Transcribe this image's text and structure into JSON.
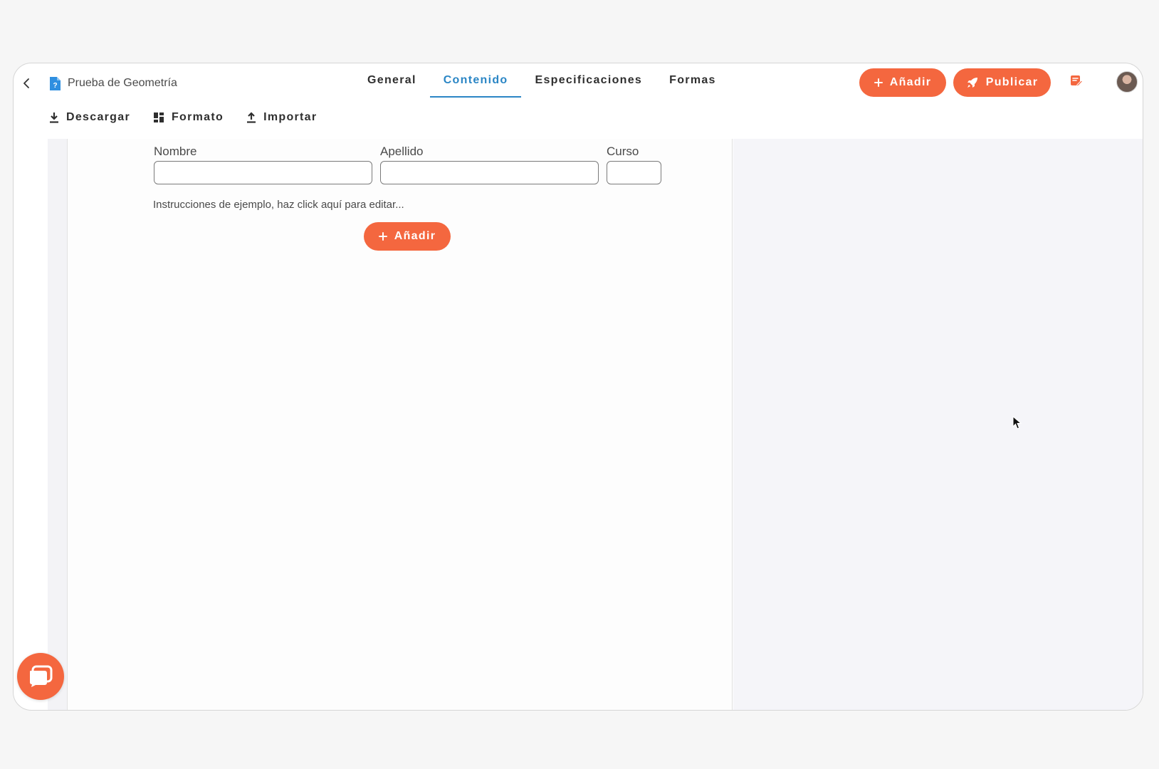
{
  "header": {
    "title": "Prueba de Geometría",
    "tabs": [
      {
        "label": "General",
        "active": false
      },
      {
        "label": "Contenido",
        "active": true
      },
      {
        "label": "Especificaciones",
        "active": false
      },
      {
        "label": "Formas",
        "active": false
      }
    ],
    "add_button": "Añadir",
    "publish_button": "Publicar"
  },
  "toolbar": {
    "download": "Descargar",
    "format": "Formato",
    "import": "Importar"
  },
  "form": {
    "fields": [
      {
        "label": "Nombre",
        "value": ""
      },
      {
        "label": "Apellido",
        "value": ""
      },
      {
        "label": "Curso",
        "value": ""
      }
    ],
    "instructions": "Instrucciones de ejemplo, haz click aquí para editar...",
    "add_button": "Añadir"
  },
  "icons": {
    "back": "chevron-left-icon",
    "document": "question-document-icon",
    "add": "plus-icon",
    "publish": "rocket-icon",
    "notes": "notes-edit-icon",
    "download": "download-icon",
    "format": "grid-layout-icon",
    "import": "upload-icon",
    "chat": "chat-bubble-icon"
  },
  "colors": {
    "accent": "#f4673f",
    "active_tab": "#2b86c5",
    "document_icon": "#2f8fe0"
  }
}
